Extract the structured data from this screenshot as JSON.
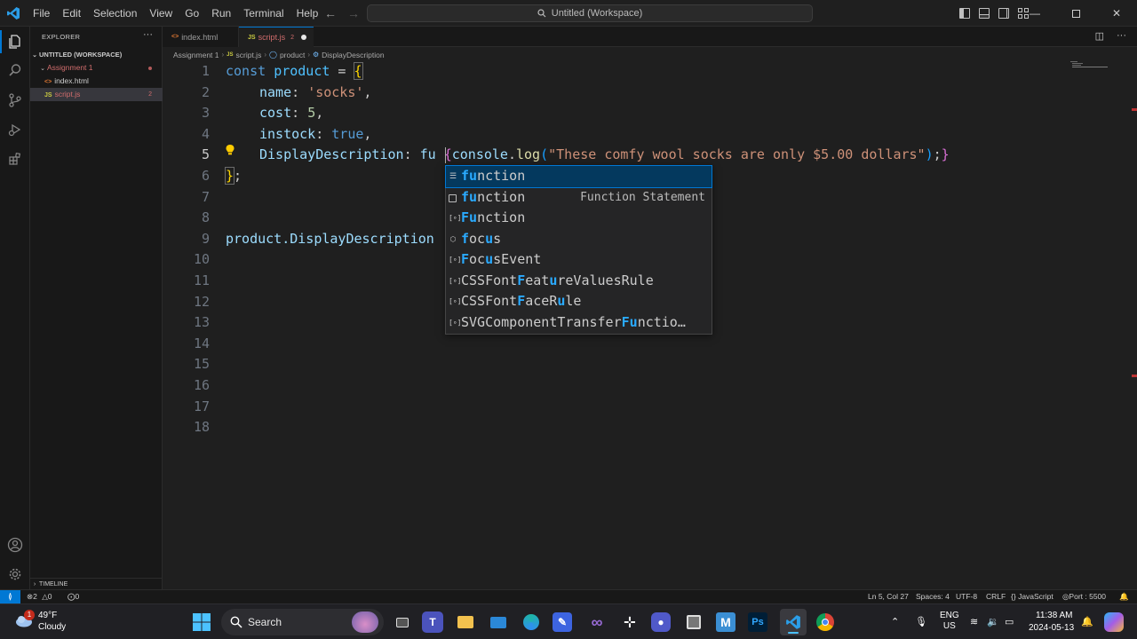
{
  "titlebar": {
    "menu": [
      "File",
      "Edit",
      "Selection",
      "View",
      "Go",
      "Run",
      "Terminal",
      "Help"
    ],
    "search_title": "Untitled (Workspace)"
  },
  "sidebar": {
    "title": "EXPLORER",
    "workspace": "UNTITLED (WORKSPACE)",
    "folder": "Assignment 1",
    "files": [
      {
        "name": "index.html",
        "icon": "<>",
        "badge": ""
      },
      {
        "name": "script.js",
        "icon": "JS",
        "badge": "2"
      }
    ],
    "timeline": "TIMELINE"
  },
  "tabs": [
    {
      "label": "index.html",
      "icon": "<>",
      "active": false
    },
    {
      "label": "script.js",
      "icon": "JS",
      "badge": "2",
      "active": true
    }
  ],
  "breadcrumbs": [
    "Assignment 1",
    "script.js",
    "product",
    "DisplayDescription"
  ],
  "editor": {
    "line_numbers": [
      "1",
      "2",
      "3",
      "4",
      "5",
      "6",
      "7",
      "8",
      "9",
      "10",
      "11",
      "12",
      "13",
      "14",
      "15",
      "16",
      "17",
      "18"
    ],
    "current_line": "5",
    "lines": {
      "l1": {
        "kw": "const",
        "var": "product",
        "eq": " = ",
        "brace": "{"
      },
      "l2": {
        "prop": "name",
        "colon": ": ",
        "str": "'socks'",
        "comma": ","
      },
      "l3": {
        "prop": "cost",
        "colon": ": ",
        "num": "5",
        "comma": ","
      },
      "l4": {
        "prop": "instock",
        "colon": ": ",
        "kw": "true",
        "comma": ","
      },
      "l5": {
        "prop": "DisplayDescription",
        "colon": ": ",
        "typed": "fu",
        "brace_open": "{",
        "obj": "console",
        "dot": ".",
        "fn": "log",
        "paren_open": "(",
        "str": "\"These comfy wool socks are only $5.00 dollars\"",
        "paren_close": ")",
        "semi": ";",
        "brace_close": "}"
      },
      "l6": {
        "brace": "}",
        "semi": ";"
      },
      "l9": {
        "text": "product.DisplayDescription"
      }
    }
  },
  "suggestions": [
    {
      "label": "function",
      "highlight": "fu",
      "rest": "nction",
      "icon": "snippet",
      "detail": ""
    },
    {
      "label": "function",
      "highlight": "fu",
      "rest": "nction",
      "icon": "keyword",
      "detail": "Function Statement"
    },
    {
      "label": "Function",
      "highlight": "Fu",
      "rest": "nction",
      "icon": "variable",
      "detail": ""
    },
    {
      "label": "focus",
      "pre": "f",
      "mid": "oc",
      "hl2": "u",
      "post": "s",
      "icon": "method",
      "detail": ""
    },
    {
      "label": "FocusEvent",
      "pre": "F",
      "mid": "oc",
      "hl2": "u",
      "post": "sEvent",
      "icon": "variable",
      "detail": ""
    },
    {
      "label": "CSSFontFeatureValuesRule",
      "pre1": "CSSFont",
      "h1": "F",
      "mid": "eat",
      "h2": "u",
      "post": "reValuesRule",
      "icon": "variable",
      "detail": ""
    },
    {
      "label": "CSSFontFaceRule",
      "pre1": "CSSFont",
      "h1": "F",
      "mid": "aceR",
      "h2": "u",
      "post": "le",
      "icon": "variable",
      "detail": ""
    },
    {
      "label": "SVGComponentTransferFunctio…",
      "pre1": "SVGComponentTransfer",
      "h1": "Fu",
      "post": "nctio…",
      "icon": "variable",
      "detail": ""
    }
  ],
  "statusbar": {
    "errors": "2",
    "warnings": "0",
    "ports": "0",
    "position": "Ln 5, Col 27",
    "spaces": "Spaces: 4",
    "encoding": "UTF-8",
    "eol": "CRLF",
    "language": "JavaScript",
    "port": "Port : 5500"
  },
  "taskbar": {
    "weather_badge": "1",
    "temperature": "49°F",
    "condition": "Cloudy",
    "search_label": "Search",
    "lang_top": "ENG",
    "lang_bottom": "US",
    "time": "11:38 AM",
    "date": "2024-05-13"
  },
  "colors": {
    "accent": "#0078d4",
    "keyword": "#569cd6",
    "string": "#ce9178",
    "number": "#b5cea8",
    "bracket": "#ffd700",
    "suggest_highlight": "#2aaaff"
  }
}
